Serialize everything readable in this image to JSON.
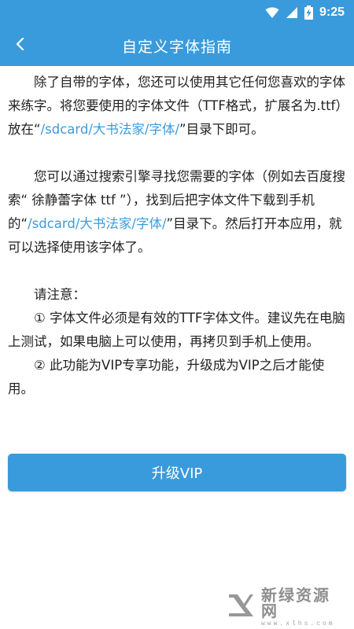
{
  "status_bar": {
    "time": "9:25",
    "icons": [
      "wifi-icon",
      "signal-icon",
      "battery-charging-icon"
    ],
    "color": "#3a9bdc"
  },
  "app_bar": {
    "back_icon": "chevron-left-icon",
    "title": "自定义字体指南"
  },
  "content": {
    "p1": {
      "a": "除了自带的字体，您还可以使用其它任何您喜欢的字体来练字。将您要使用的字体文件（TTF格式，扩展名为.ttf）放在“",
      "path": "/sdcard/大书法家/字体/",
      "b": "”目录下即可。"
    },
    "p2": {
      "a": "您可以通过搜索引擎寻找您需要的字体（例如去百度搜索“ 徐静蕾字体 ttf ”），找到后把字体文件下载到手机的“",
      "path": "/sdcard/大书法家/字体/",
      "b": "”目录下。然后打开本应用，就可以选择使用该字体了。"
    },
    "note_title": "请注意：",
    "note1": "① 字体文件必须是有效的TTF字体文件。建议先在电脑上测试，如果电脑上可以使用，再拷贝到手机上使用。",
    "note2": "② 此功能为VIP专享功能，升级成为VIP之后才能使用。",
    "path_color": "#3a9bdc"
  },
  "upgrade_button": {
    "label": "升级VIP",
    "color": "#3a9bdc"
  },
  "watermark": {
    "main": "新绿资源网",
    "sub": "www.xlhs.com"
  }
}
